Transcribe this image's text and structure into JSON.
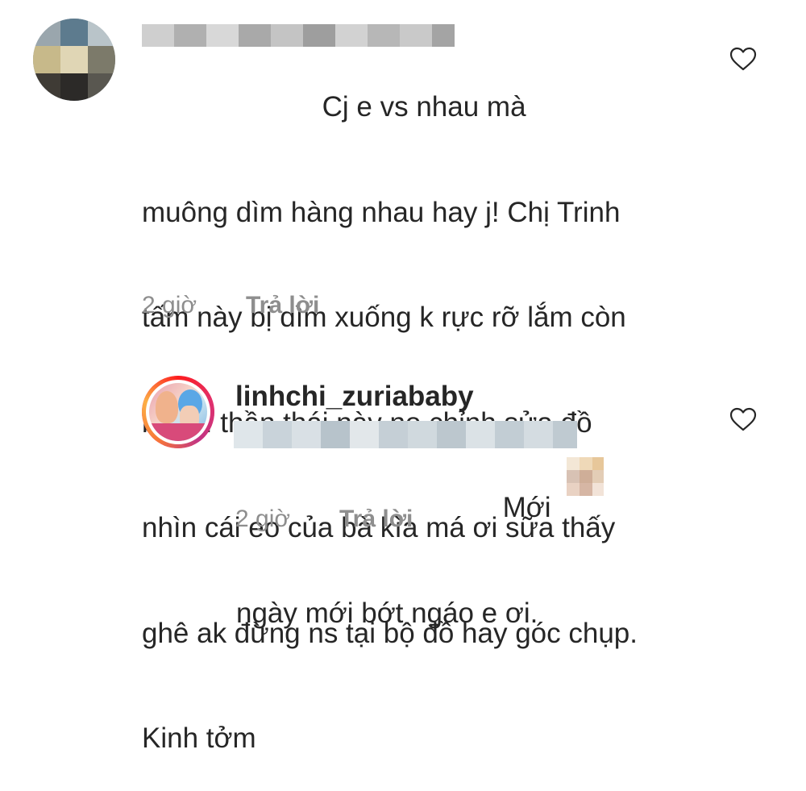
{
  "comments": [
    {
      "username_hidden": true,
      "text_lines": [
        "                       Cj e vs nhau mà",
        "muông dìm hàng nhau hay j! Chị Trinh",
        "tấm này bị dìm xuống k rực rỡ lắm còn",
        "bà thì thần thái này nọ chỉnh sửa đồ",
        "nhìn cái eo của bà kìa má ơi sữa thấy",
        "ghê ak đừng ns tại bộ đồ hay góc chụp.",
        "Kinh tởm"
      ],
      "time": "2 giờ",
      "reply_label": "Trả lời",
      "like_icon": "heart-outline-icon"
    },
    {
      "username": "linhchi_zuriababy",
      "text_lines": [
        "                                  Mới",
        "ngày mới bớt ngáo e ơi."
      ],
      "time": "2 giờ",
      "reply_label": "Trả lời",
      "like_icon": "heart-outline-icon"
    }
  ],
  "colors": {
    "text": "#262626",
    "meta": "#8e8e8e",
    "story_ring": [
      "#fd1d1d",
      "#e1306c",
      "#c13584",
      "#f77737",
      "#fcaf45"
    ]
  }
}
